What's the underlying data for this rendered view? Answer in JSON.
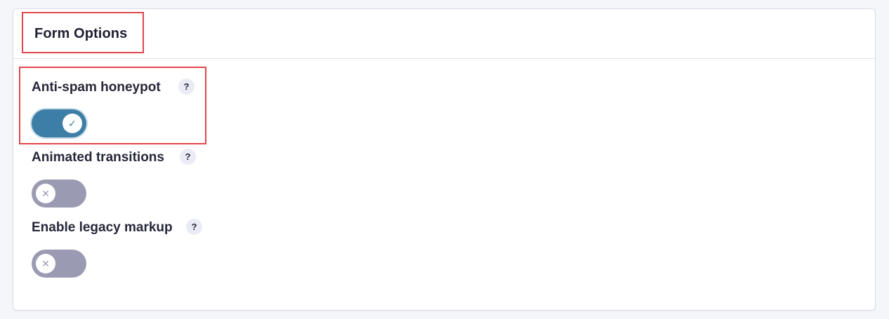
{
  "panel": {
    "title": "Form Options"
  },
  "options": [
    {
      "label": "Anti-spam honeypot",
      "help": "?",
      "enabled": true,
      "knob_icon": "check-icon",
      "knob_glyph": "✓"
    },
    {
      "label": "Animated transitions",
      "help": "?",
      "enabled": false,
      "knob_icon": "x-icon",
      "knob_glyph": "✕"
    },
    {
      "label": "Enable legacy markup",
      "help": "?",
      "enabled": false,
      "knob_icon": "x-icon",
      "knob_glyph": "✕"
    }
  ],
  "colors": {
    "toggle_on": "#3d7ea6",
    "toggle_off": "#9b9ab3",
    "highlight": "#e0474c",
    "help_bg": "#ebebf6"
  }
}
